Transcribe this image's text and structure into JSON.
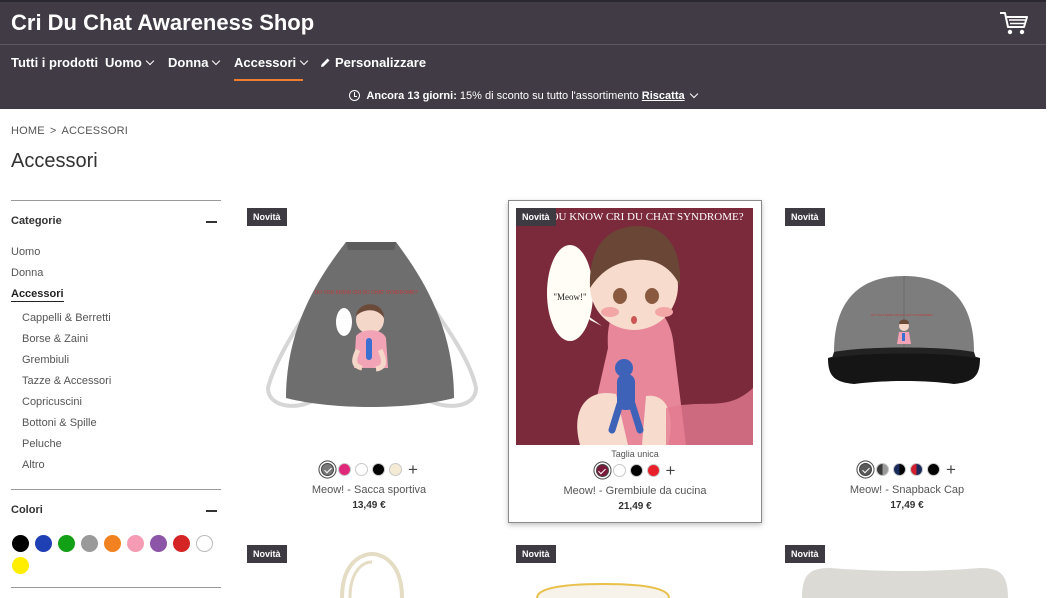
{
  "header": {
    "shop_title": "Cri Du Chat Awareness Shop",
    "cart_icon": "shopping-cart-icon",
    "background_color": "#403b45",
    "accent_color": "#ef7d2e"
  },
  "nav": {
    "items": [
      {
        "label": "Tutti i prodotti",
        "has_dropdown": false
      },
      {
        "label": "Uomo",
        "has_dropdown": true
      },
      {
        "label": "Donna",
        "has_dropdown": true
      },
      {
        "label": "Accessori",
        "has_dropdown": true,
        "active": true
      },
      {
        "label": "Personalizzare",
        "icon": "pencil-icon"
      }
    ]
  },
  "promo": {
    "icon": "clock-icon",
    "bold_text": "Ancora 13 giorni:",
    "text": " 15% di sconto su tutto l'assortimento ",
    "link": "Riscatta"
  },
  "breadcrumb": {
    "home": "HOME",
    "separator": ">",
    "current": "ACCESSORI"
  },
  "page_title": "Accessori",
  "filters": {
    "categories": {
      "title": "Categorie",
      "items": [
        "Uomo",
        "Donna",
        "Accessori"
      ],
      "active": "Accessori",
      "subitems": [
        "Cappelli & Berretti",
        "Borse & Zaini",
        "Grembiuli",
        "Tazze & Accessori",
        "Copricuscini",
        "Bottoni & Spille",
        "Peluche",
        "Altro"
      ]
    },
    "colors": {
      "title": "Colori",
      "swatches": [
        "#000000",
        "#1f3fb4",
        "#12a016",
        "#9a9a9a",
        "#f28220",
        "#f59cb4",
        "#8d55a8",
        "#d42424",
        "#ffffff",
        "#ffee00"
      ]
    }
  },
  "products": [
    {
      "badge": "Novità",
      "name": "Meow! - Sacca sportiva",
      "price": "13,49 €",
      "swatches": [
        "#7a7a7a",
        "#e0287a",
        "#ffffff",
        "#000000",
        "#f5ebd5"
      ],
      "selected_swatch": 0
    },
    {
      "badge": "Novità",
      "name": "Meow! - Grembiule da cucina",
      "price": "21,49 €",
      "size_note": "Taglia unica",
      "image_text": "DO YOU KNOW CRI DU CHAT SYNDROME?",
      "bubble_text": "\"Meow!\"",
      "swatches": [
        "#7a1a3a",
        "#ffffff",
        "#000000",
        "#e8202a"
      ],
      "selected_swatch": 0
    },
    {
      "badge": "Novità",
      "name": "Meow! - Snapback Cap",
      "price": "17,49 €",
      "swatches": [
        "#5a5a5a",
        "#3a3a3a",
        "#1a2a5a",
        "#d01f2f",
        "#000000"
      ],
      "selected_swatch": 0
    },
    {
      "badge": "Novità"
    },
    {
      "badge": "Novità"
    },
    {
      "badge": "Novità"
    }
  ]
}
